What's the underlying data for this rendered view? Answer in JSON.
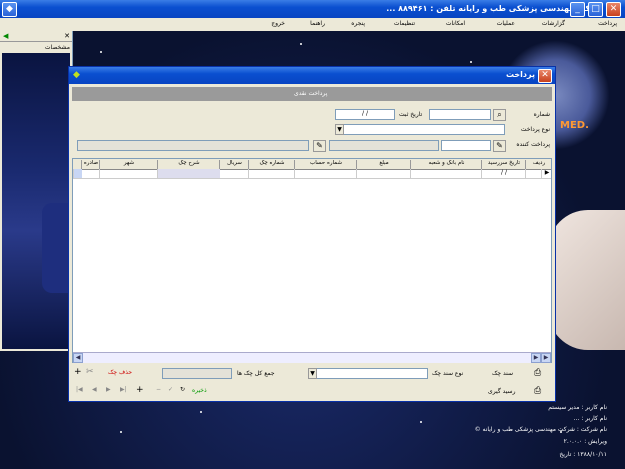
{
  "main_window": {
    "title": "شرکت مهندسی پزشکی طب و رایانه   تلفن : ۸۸۹۴۶۱ ..."
  },
  "main_menu": [
    "پرداخت",
    "گزارشات",
    "عملیات",
    "امکانات",
    "تنظیمات",
    "پنجره",
    "راهنما",
    "خروج"
  ],
  "left_panel": {
    "title": "مشخصات"
  },
  "dialog": {
    "title": "پرداخت",
    "subtitle": "پرداخت نقدی",
    "fields": {
      "number_label": "شماره",
      "date_label": "تاریخ ثبت",
      "date_value": "/ /",
      "type_label": "نوع پرداخت",
      "payee_label": "پرداخت کننده",
      "number_value": "",
      "type_value": "",
      "payee_value": "",
      "payee_name": "",
      "extra_value": ""
    },
    "table": {
      "columns": [
        "ردیف",
        "تاریخ سررسید",
        "نام بانک و شعبه",
        "مبلغ",
        "شماره حساب",
        "شماره چک",
        "سریال",
        "شرح چک",
        "شهر",
        "صادره"
      ],
      "rows": [
        {
          "index": "",
          "due_date": "/ /"
        }
      ]
    },
    "footer": {
      "check_label": "سند چک",
      "check_type_label": "نوع سند چک",
      "total_label": "جمع کل چک ها",
      "total_value": "",
      "delete_label": "حذف چک",
      "receipt_label": "رسید گیری",
      "save_label": "ذخیره"
    }
  },
  "bottom_info": [
    "نام کاربر : مدیر سیستم",
    "نام کاربر : ...",
    "نام شرکت : شرکت مهندسی پزشکی طب و رایانه ©",
    "ویرایش : ۲.۰.۰.۰",
    "۱۳۸۸/۱۰/۱۱ : تاریخ"
  ],
  "colors": {
    "titlebar": "#0a4fd0",
    "dialog_bg": "#ece9d8",
    "desktop": "#0a1230",
    "logo_accent": "#ff9933"
  }
}
